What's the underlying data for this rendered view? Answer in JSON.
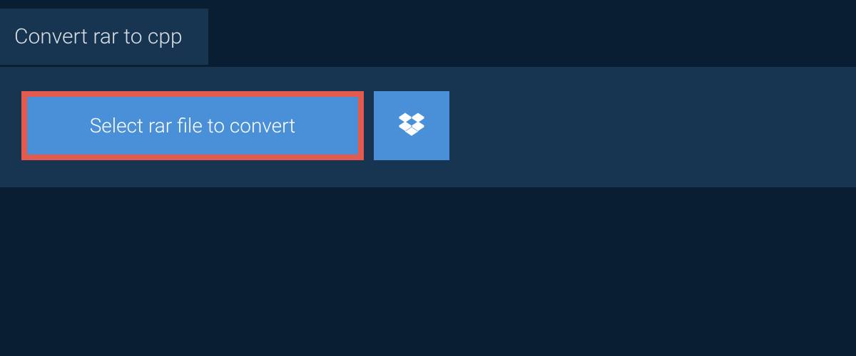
{
  "tab": {
    "title": "Convert rar to cpp"
  },
  "panel": {
    "select_button_label": "Select rar file to convert"
  },
  "colors": {
    "background": "#0a1e33",
    "panel": "#173551",
    "button": "#4a90d9",
    "highlight_border": "#e35a4f",
    "text_light": "#d8dee4",
    "text_white": "#ffffff"
  }
}
